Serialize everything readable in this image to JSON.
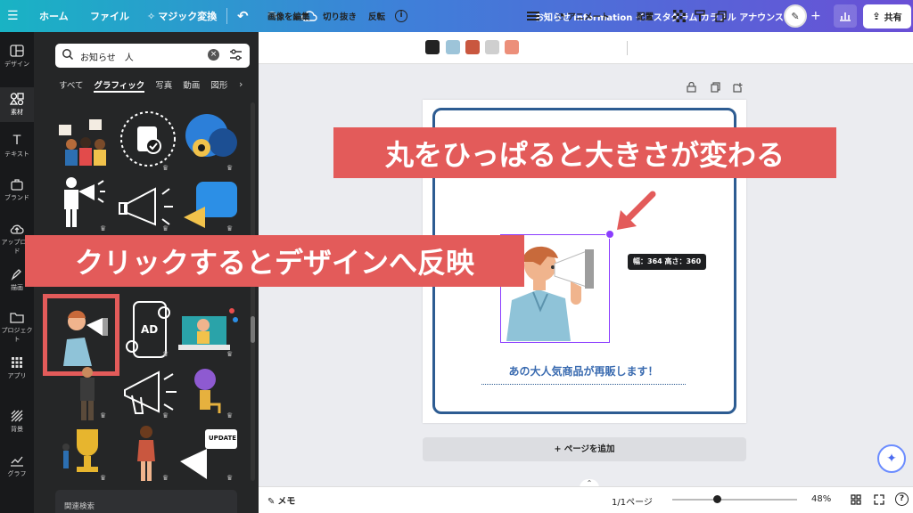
{
  "topbar": {
    "home": "ホーム",
    "file": "ファイル",
    "magic": "マジック変換",
    "title": "お知らせ information インスタグラム カラフル アナウンス",
    "share": "共有"
  },
  "rail": {
    "items": [
      "デザイン",
      "素材",
      "テキスト",
      "ブランド",
      "アップロード",
      "描画",
      "プロジェクト",
      "アプリ",
      "背景",
      "グラフ"
    ]
  },
  "panel": {
    "search_value": "お知らせ　人",
    "tabs": [
      "すべて",
      "グラフィック",
      "写真",
      "動画",
      "図形"
    ],
    "related": "関連検索",
    "thumb_labels": {
      "ad": "AD",
      "update": "UPDATE"
    }
  },
  "toolbar": {
    "edit_image": "画像を編集",
    "crop": "切り抜き",
    "flip": "反転",
    "animate": "アニメート",
    "position": "配置",
    "colors": [
      "#222222",
      "#9dc4d9",
      "#c9573f",
      "#cfcfcf",
      "#ec8f7a"
    ]
  },
  "design": {
    "caption": "あの大人気商品が再販します！",
    "size_tooltip": "幅：364 高さ：360",
    "add_page": "+ ページを追加"
  },
  "bottombar": {
    "notes": "メモ",
    "page_count": "1/1ページ",
    "zoom": "48%",
    "zoom_level": 0.48
  },
  "annotations": {
    "resize_hint": "丸をひっぱると大きさが変わる",
    "click_hint": "クリックするとデザインへ反映"
  }
}
